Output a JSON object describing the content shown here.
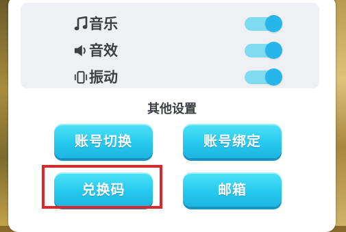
{
  "settings": {
    "toggles": [
      {
        "label": "音乐",
        "icon": "music-note-icon",
        "on": true
      },
      {
        "label": "音效",
        "icon": "speaker-icon",
        "on": true
      },
      {
        "label": "振动",
        "icon": "vibration-icon",
        "on": true
      }
    ],
    "other_title": "其他设置",
    "buttons": {
      "switch_account": "账号切换",
      "bind_account": "账号绑定",
      "redeem_code": "兑换码",
      "mailbox": "邮箱"
    },
    "colors": {
      "button": "#26c9ee",
      "toggle_knob": "#26b6ea",
      "toggle_track": "#7fdcf0",
      "highlight": "#e0262a"
    }
  }
}
